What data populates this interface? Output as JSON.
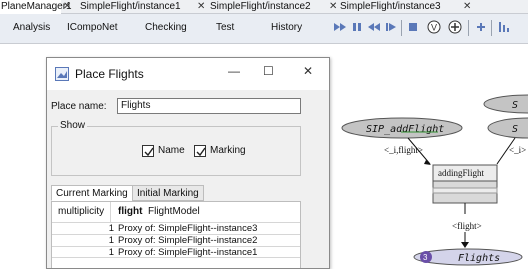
{
  "tabs": [
    {
      "label": "PlaneManager1",
      "active": true
    },
    {
      "label": "SimpleFlight/instance1",
      "active": false
    },
    {
      "label": "SimpleFlight/instance2",
      "active": false
    },
    {
      "label": "SimpleFlight/instance3",
      "active": false
    }
  ],
  "tab_close_glyph": "✕",
  "menu": [
    "Analysis",
    "ICompoNet",
    "Checking",
    "Test",
    "History"
  ],
  "toolbar_icons": [
    "fast-forward-icon",
    "pause-icon",
    "rewind-icon",
    "step-forward-icon",
    "stop-icon",
    "v-circle-icon",
    "plus-circle-icon",
    "add-icon",
    "chart-icon"
  ],
  "dialog": {
    "title": "Place Flights",
    "minimize_glyph": "—",
    "maximize_glyph": "☐",
    "close_glyph": "✕",
    "place_name_label": "Place name:",
    "place_name_value": "Flights",
    "show_label": "Show",
    "name_checkbox": {
      "label": "Name",
      "checked": true
    },
    "marking_checkbox": {
      "label": "Marking",
      "checked": true
    },
    "marking_tabs": [
      "Current Marking",
      "Initial Marking"
    ],
    "table": {
      "col_multiplicity": "multiplicity",
      "col_flight": "flight",
      "col_type": "FlightModel",
      "rows": [
        {
          "count": "1",
          "value": "Proxy of: SimpleFlight--instance3"
        },
        {
          "count": "1",
          "value": "Proxy of: SimpleFlight--instance2"
        },
        {
          "count": "1",
          "value": "Proxy of: SimpleFlight--instance1"
        }
      ]
    }
  },
  "diagram": {
    "place_sip_addflight": "SIP_addFlight",
    "arc_label_i_flight": "<_i,flight>",
    "arc_label_right": "<_i>",
    "transition_label": "addingFlight",
    "arc_label_flight": "<flight>",
    "place_flights": "Flights",
    "token_count": "3",
    "cut_place_label_top": "S",
    "cut_place_label_mid": "S"
  },
  "colors": {
    "place_fill": "#c4c4c4",
    "highlight_green": "#2f8f2f",
    "token_purple": "#6a4fa8",
    "flights_place_fill": "#d4d4ea",
    "tab_active": "#ffffff"
  }
}
